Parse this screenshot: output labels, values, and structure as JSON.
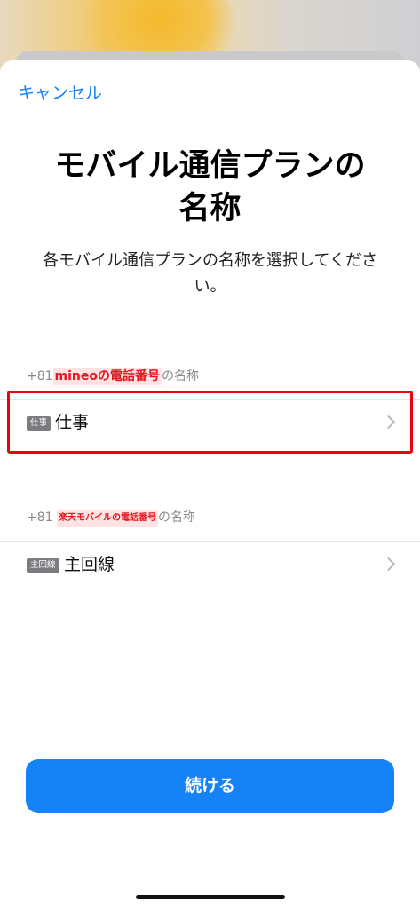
{
  "header": {
    "cancel_label": "キャンセル"
  },
  "title": {
    "line1": "モバイル通信プランの",
    "line2": "名称"
  },
  "subtitle": {
    "line1": "各モバイル通信プランの名称を選択してくださ",
    "line2": "い。"
  },
  "plans": [
    {
      "prefix": "+81",
      "redacted_text": "mineoの電話番号",
      "suffix": "の名称",
      "tag": "仕事",
      "name": "仕事",
      "highlighted": true
    },
    {
      "prefix": "+81",
      "redacted_text": "楽天モバイルの電話番号",
      "suffix": "の名称",
      "tag": "主回線",
      "name": "主回線",
      "highlighted": false
    }
  ],
  "footer": {
    "continue_label": "続ける"
  },
  "colors": {
    "accent": "#1582f6",
    "highlight": "#ee0010",
    "redaction": "#e6141e"
  },
  "icons": {
    "row_chevron": "chevron-right-icon"
  }
}
